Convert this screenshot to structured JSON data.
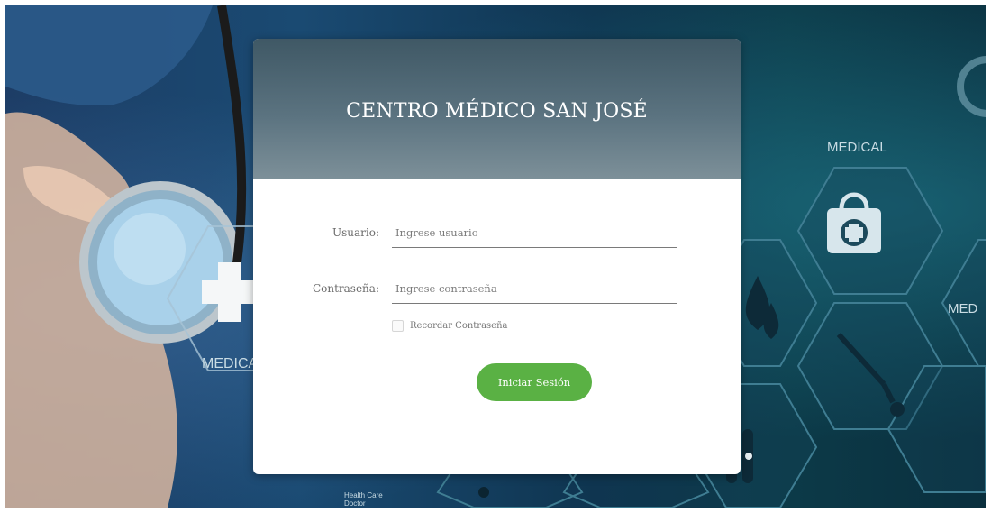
{
  "header": {
    "title": "CENTRO MÉDICO SAN JOSÉ"
  },
  "form": {
    "username_label": "Usuario:",
    "username_placeholder": "Ingrese usuario",
    "password_label": "Contraseña:",
    "password_placeholder": "Ingrese contraseña",
    "remember_label": "Recordar Contraseña",
    "submit_label": "Iniciar Sesión"
  },
  "background": {
    "medical_text_right": "MEDICAL",
    "medical_text_left": "MEDICA",
    "medical_text_edge": "MED",
    "caption_lines": [
      "Health Care",
      "Doctor"
    ]
  },
  "colors": {
    "header_top": "#3f5865",
    "header_bottom": "#7d9099",
    "button": "#5ab144",
    "background": "#0f3550"
  },
  "icons": [
    "stethoscope-icon",
    "medical-cross-icon",
    "first-aid-kit-icon",
    "blood-drop-icon",
    "syringe-icon",
    "test-tube-icon"
  ]
}
